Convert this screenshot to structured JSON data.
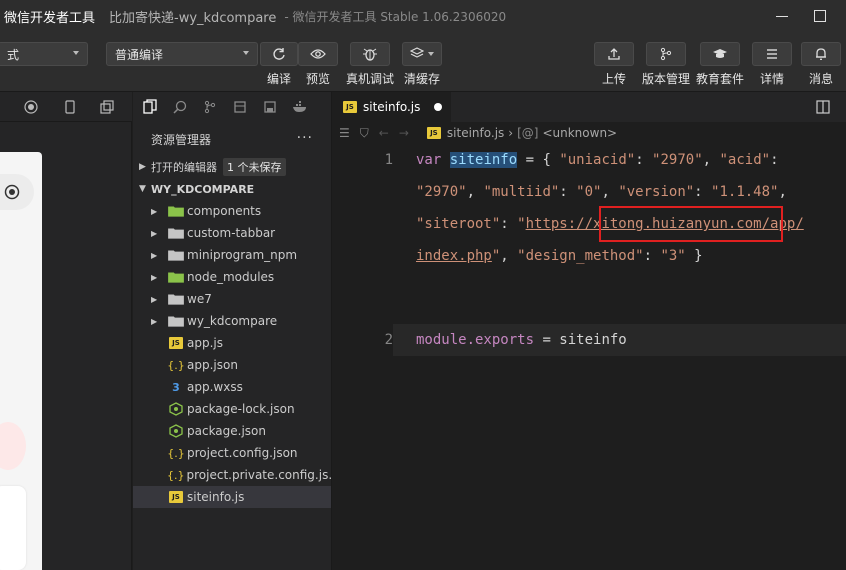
{
  "window": {
    "app_title": "微信开发者工具",
    "project_title": "比加寄快递-wy_kdcompare",
    "version": "- 微信开发者工具 Stable 1.06.2306020"
  },
  "toolbar": {
    "mode_select": "式",
    "compile_select": "普通编译",
    "buttons": [
      {
        "label": "编译",
        "icon": "compile-icon"
      },
      {
        "label": "预览",
        "icon": "eye-icon"
      },
      {
        "label": "真机调试",
        "icon": "bug-icon"
      },
      {
        "label": "清缓存",
        "icon": "layers-icon"
      },
      {
        "label": "上传",
        "icon": "upload-icon"
      },
      {
        "label": "版本管理",
        "icon": "branch-icon"
      },
      {
        "label": "教育套件",
        "icon": "graduation-cap-icon"
      },
      {
        "label": "详情",
        "icon": "menu-icon"
      },
      {
        "label": "消息",
        "icon": "bell-icon"
      }
    ]
  },
  "explorer": {
    "title": "资源管理器",
    "more": "···",
    "open_editors": "打开的编辑器",
    "unsaved_badge": "1 个未保存",
    "project_root": "WY_KDCOMPARE",
    "folders": [
      {
        "name": "components",
        "color": "#8bc34a"
      },
      {
        "name": "custom-tabbar",
        "color": "#c5c5c5"
      },
      {
        "name": "miniprogram_npm",
        "color": "#c5c5c5"
      },
      {
        "name": "node_modules",
        "color": "#8bc34a"
      },
      {
        "name": "we7",
        "color": "#c5c5c5"
      },
      {
        "name": "wy_kdcompare",
        "color": "#c5c5c5"
      }
    ],
    "files": [
      {
        "name": "app.js",
        "icon": "js"
      },
      {
        "name": "app.json",
        "icon": "json"
      },
      {
        "name": "app.wxss",
        "icon": "css"
      },
      {
        "name": "package-lock.json",
        "icon": "npm"
      },
      {
        "name": "package.json",
        "icon": "npm"
      },
      {
        "name": "project.config.json",
        "icon": "json"
      },
      {
        "name": "project.private.config.js...",
        "icon": "json"
      },
      {
        "name": "siteinfo.js",
        "icon": "js",
        "selected": true
      }
    ]
  },
  "editor": {
    "tab_name": "siteinfo.js",
    "breadcrumb_file": "siteinfo.js",
    "breadcrumb_symbol": "<unknown>",
    "line_numbers": [
      "1",
      "2"
    ],
    "code": {
      "l1a_kw": "var",
      "l1a_var": "siteinfo",
      "l1a_rest1": " = { ",
      "l1a_k1": "\"uniacid\"",
      "l1a_p1": ": ",
      "l1a_v1": "\"2970\"",
      "l1a_p2": ", ",
      "l1a_k2": "\"acid\"",
      "l1a_p3": ":",
      "l1b_v2": "\"2970\"",
      "l1b_p1": ", ",
      "l1b_k3": "\"multiid\"",
      "l1b_p2": ": ",
      "l1b_v3": "\"0\"",
      "l1b_p3": ", ",
      "l1b_k4": "\"version\"",
      "l1b_p4": ": ",
      "l1b_v4": "\"1.1.48\"",
      "l1b_p5": ",",
      "l1c_k5": "\"siteroot\"",
      "l1c_p1": ": ",
      "l1c_q": "\"",
      "l1c_url": "https://xitong.huizanyun.com/app/",
      "l1d_url": "index.php",
      "l1d_q": "\"",
      "l1d_p1": ", ",
      "l1d_k6": "\"design_method\"",
      "l1d_p2": ": ",
      "l1d_v6": "\"3\"",
      "l1d_p3": " }",
      "l2_kw": "module.exports",
      "l2_rest": " = siteinfo"
    }
  }
}
